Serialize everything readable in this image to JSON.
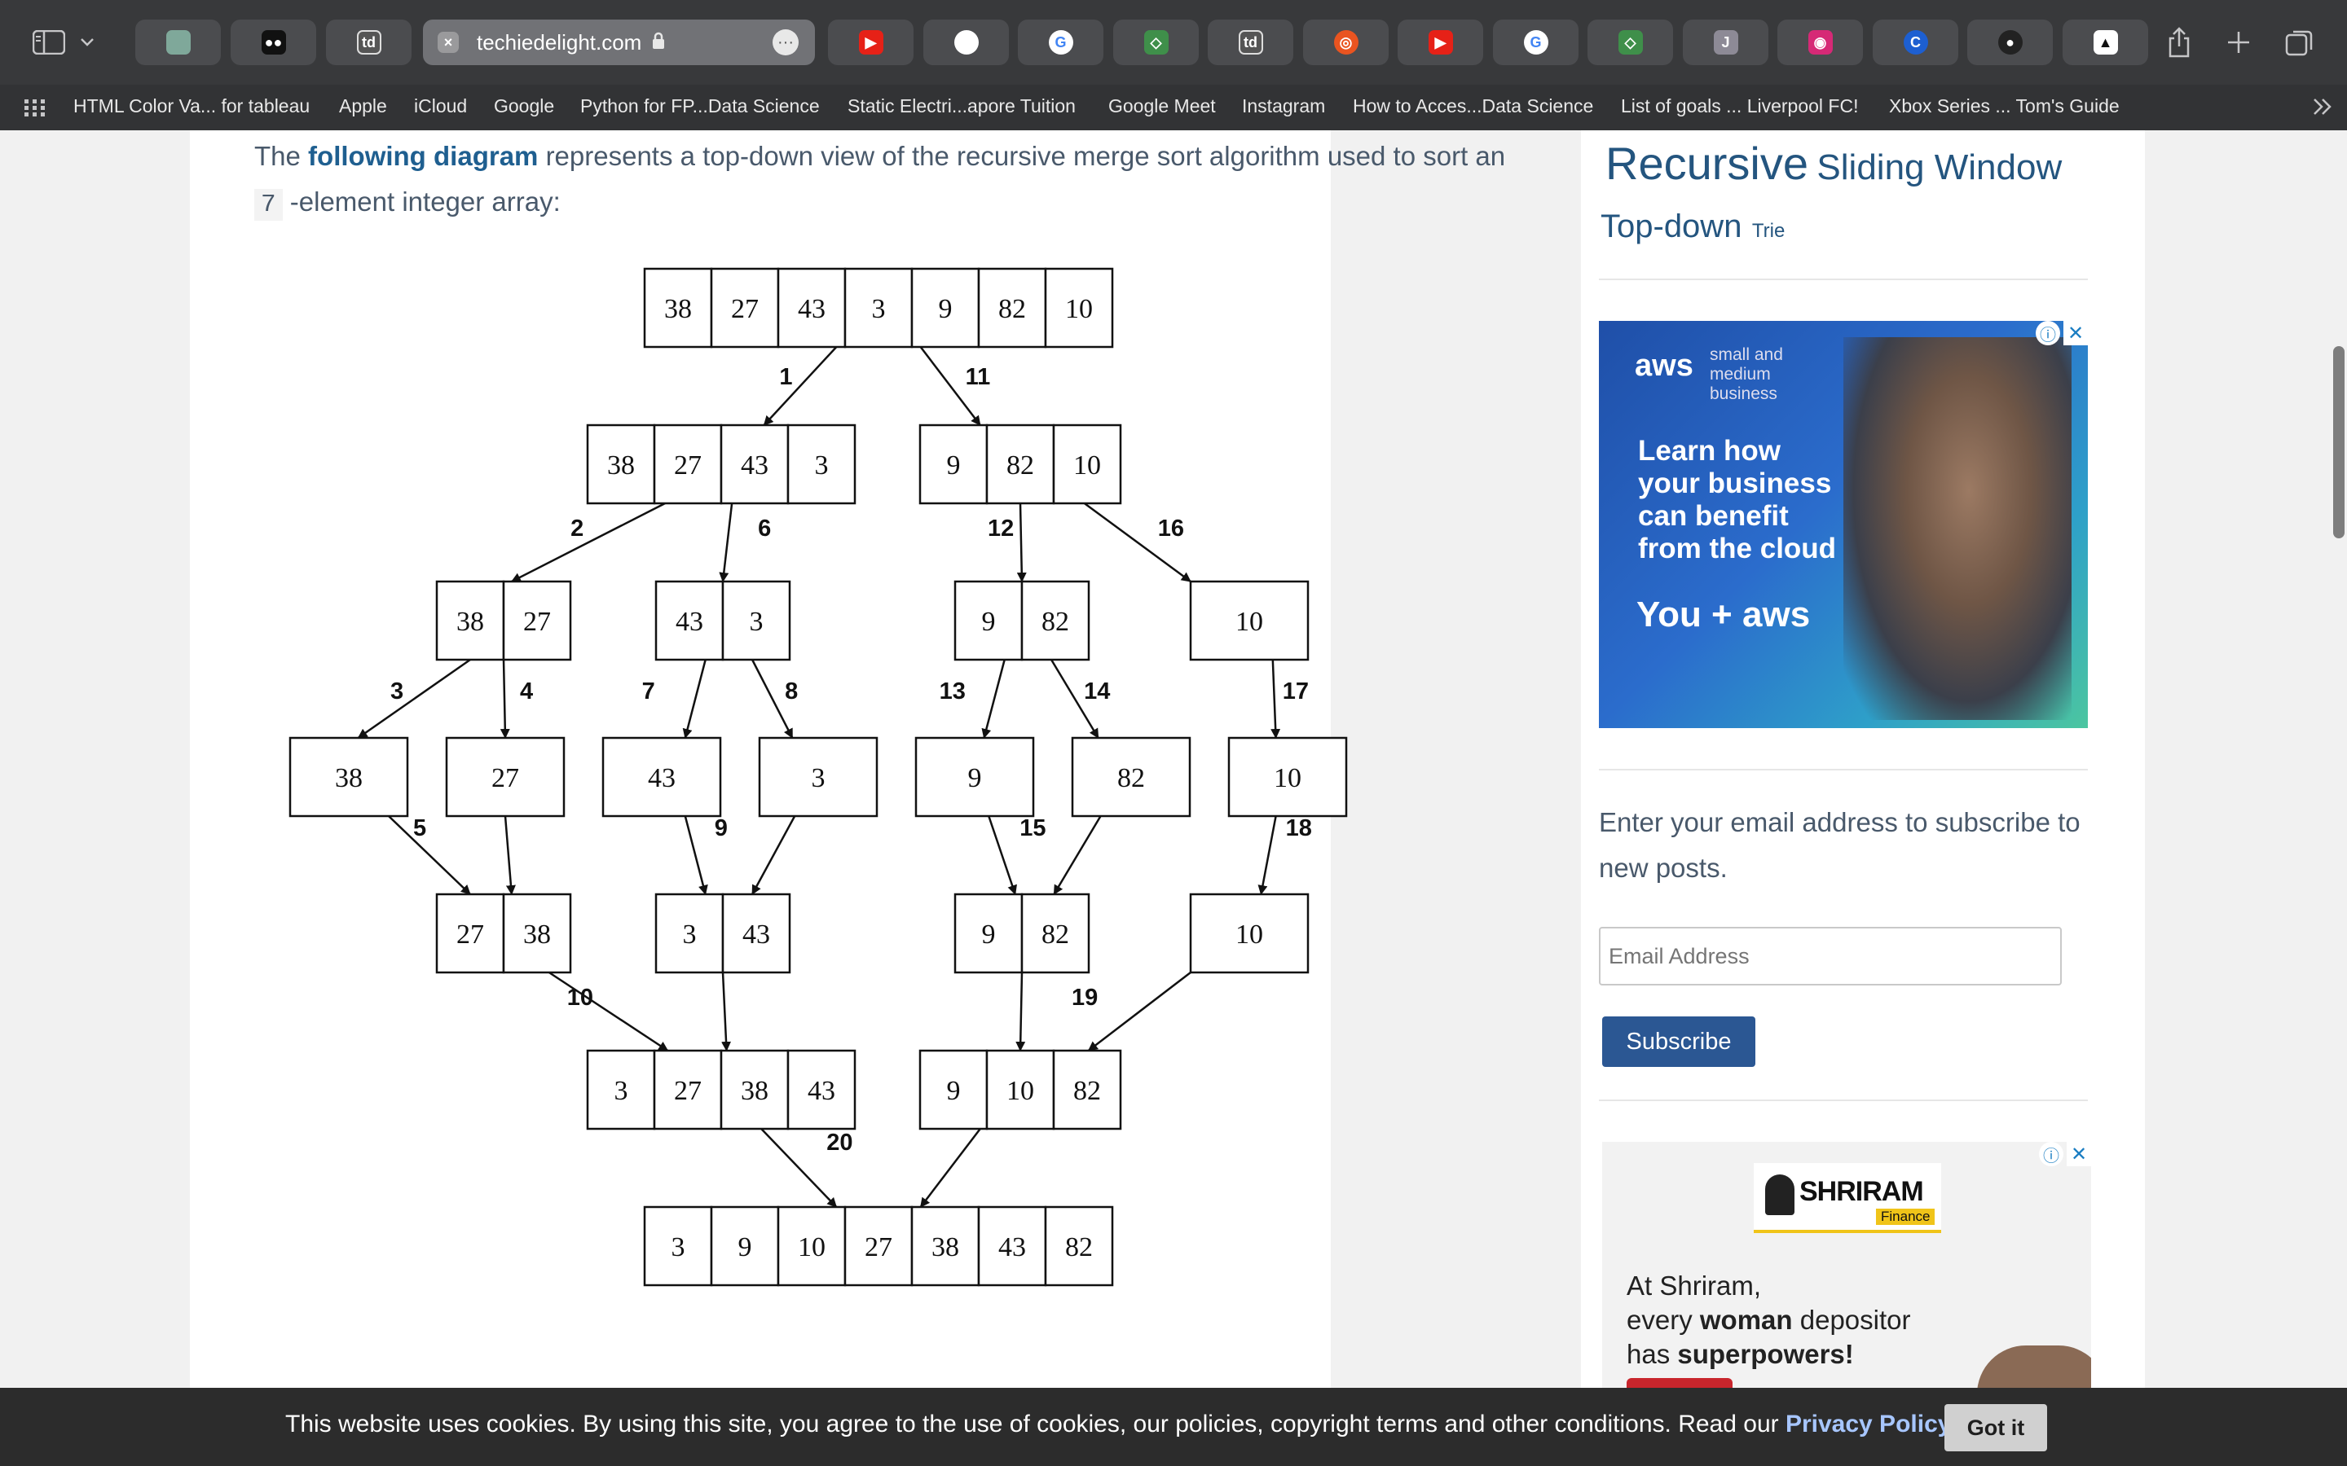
{
  "browser": {
    "active_tab": {
      "domain": "techiedelight.com"
    },
    "tab_icons": [
      "chatgpt-icon",
      "medium-icon",
      "td-icon",
      "youtube-icon",
      "apple-icon",
      "google-icon",
      "python-icon",
      "td-icon",
      "ubuntu-icon",
      "youtube-icon",
      "google-icon",
      "python-icon",
      "j-icon",
      "instagram-icon",
      "c-icon",
      "github-icon",
      "playstation-icon"
    ],
    "tab_labels": {
      "td": "td",
      "j": "J",
      "c": "C"
    }
  },
  "bookmarks": [
    "HTML Color Va... for tableau",
    "Apple",
    "iCloud",
    "Google",
    "Python for FP...Data Science",
    "Static Electri...apore Tuition",
    "Google Meet",
    "Instagram",
    "How to Acces...Data Science",
    "List of goals ... Liverpool FC!",
    "Xbox Series ... Tom's Guide"
  ],
  "article": {
    "intro_prefix": "The",
    "intro_link": "following diagram",
    "intro_middle": "represents a top-down view of the recursive merge sort algorithm used to sort an",
    "intro_code": "7",
    "intro_suffix": "-element integer array:"
  },
  "diagram": {
    "levels": [
      [
        [
          "38",
          "27",
          "43",
          "3",
          "9",
          "82",
          "10"
        ]
      ],
      [
        [
          "38",
          "27",
          "43",
          "3"
        ],
        [
          "9",
          "82",
          "10"
        ]
      ],
      [
        [
          "38",
          "27"
        ],
        [
          "43",
          "3"
        ],
        [
          "9",
          "82"
        ],
        [
          "10"
        ]
      ],
      [
        [
          "38"
        ],
        [
          "27"
        ],
        [
          "43"
        ],
        [
          "3"
        ],
        [
          "9"
        ],
        [
          "82"
        ],
        [
          "10"
        ]
      ],
      [
        [
          "27",
          "38"
        ],
        [
          "3",
          "43"
        ],
        [
          "9",
          "82"
        ],
        [
          "10"
        ]
      ],
      [
        [
          "3",
          "27",
          "38",
          "43"
        ],
        [
          "9",
          "10",
          "82"
        ]
      ],
      [
        [
          "3",
          "9",
          "10",
          "27",
          "38",
          "43",
          "82"
        ]
      ]
    ],
    "step_labels": [
      "1",
      "11",
      "2",
      "6",
      "12",
      "16",
      "3",
      "4",
      "7",
      "8",
      "13",
      "14",
      "17",
      "5",
      "9",
      "15",
      "18",
      "10",
      "19",
      "20"
    ]
  },
  "sidebar": {
    "tags": {
      "recursive": "Recursive",
      "sliding_window": "Sliding Window",
      "top_down": "Top-down",
      "trie": "Trie"
    },
    "ad1": {
      "brand": "aws",
      "brand_sub": "small and medium business",
      "headline": "Learn how your business can benefit from the cloud",
      "tagline_prefix": "You +",
      "tagline_brand": "aws"
    },
    "subscribe_text": "Enter your email address to subscribe to new posts.",
    "email_placeholder": "Email Address",
    "subscribe_label": "Subscribe",
    "ad2": {
      "brand": "SHRIRAM",
      "brand_sub": "Finance",
      "line1": "At Shriram,",
      "line2_prefix": "every",
      "line2_bold": "woman",
      "line2_suffix": "depositor",
      "line3_prefix": "has",
      "line3_bold": "superpowers!"
    }
  },
  "cookie": {
    "text": "This website uses cookies. By using this site, you agree to the use of cookies, our policies, copyright terms and other conditions. Read our",
    "link": "Privacy Policy",
    "period": ".",
    "button": "Got it"
  }
}
